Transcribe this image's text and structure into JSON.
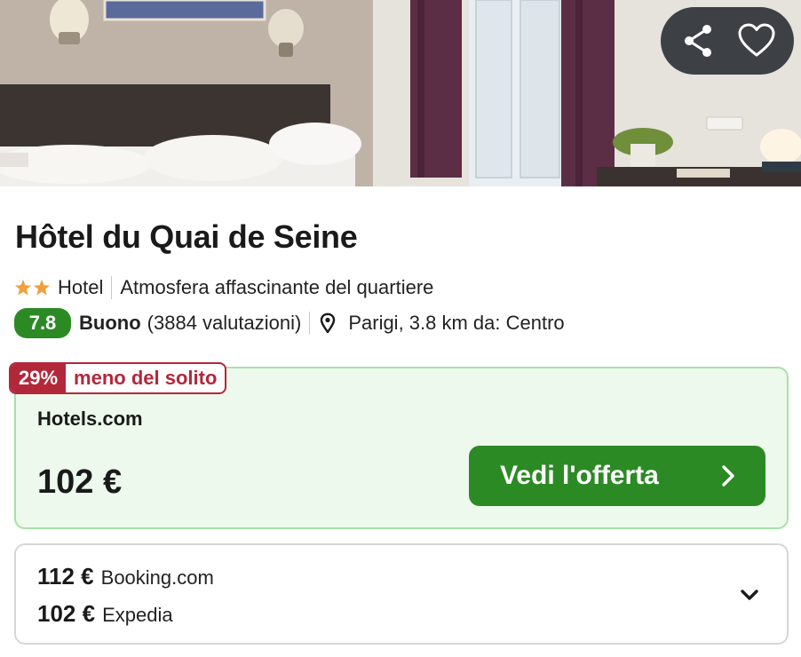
{
  "hotel": {
    "name": "Hôtel du Quai de Seine",
    "stars": 2,
    "type": "Hotel",
    "highlight": "Atmosfera affascinante del quartiere",
    "rating": "7.8",
    "rating_word": "Buono",
    "reviews": "(3884 valutazioni)",
    "location": "Parigi, 3.8 km da: Centro"
  },
  "deal": {
    "discount": "29%",
    "discount_text": "meno del solito",
    "provider": "Hotels.com",
    "price": "102 €",
    "cta_label": "Vedi l'offerta"
  },
  "other_offers": [
    {
      "price": "112 €",
      "provider": "Booking.com"
    },
    {
      "price": "102 €",
      "provider": "Expedia"
    }
  ],
  "colors": {
    "accent_green": "#2c8a25",
    "deal_bg": "#ecf9ec",
    "deal_border": "#a8e0a6",
    "discount_red": "#b3273b",
    "star": "#f0a03c"
  },
  "icons": {
    "share": "share-icon",
    "favorite": "heart-icon",
    "location": "map-pin-icon",
    "cta_arrow": "chevron-right-icon",
    "expand": "chevron-down-icon"
  }
}
